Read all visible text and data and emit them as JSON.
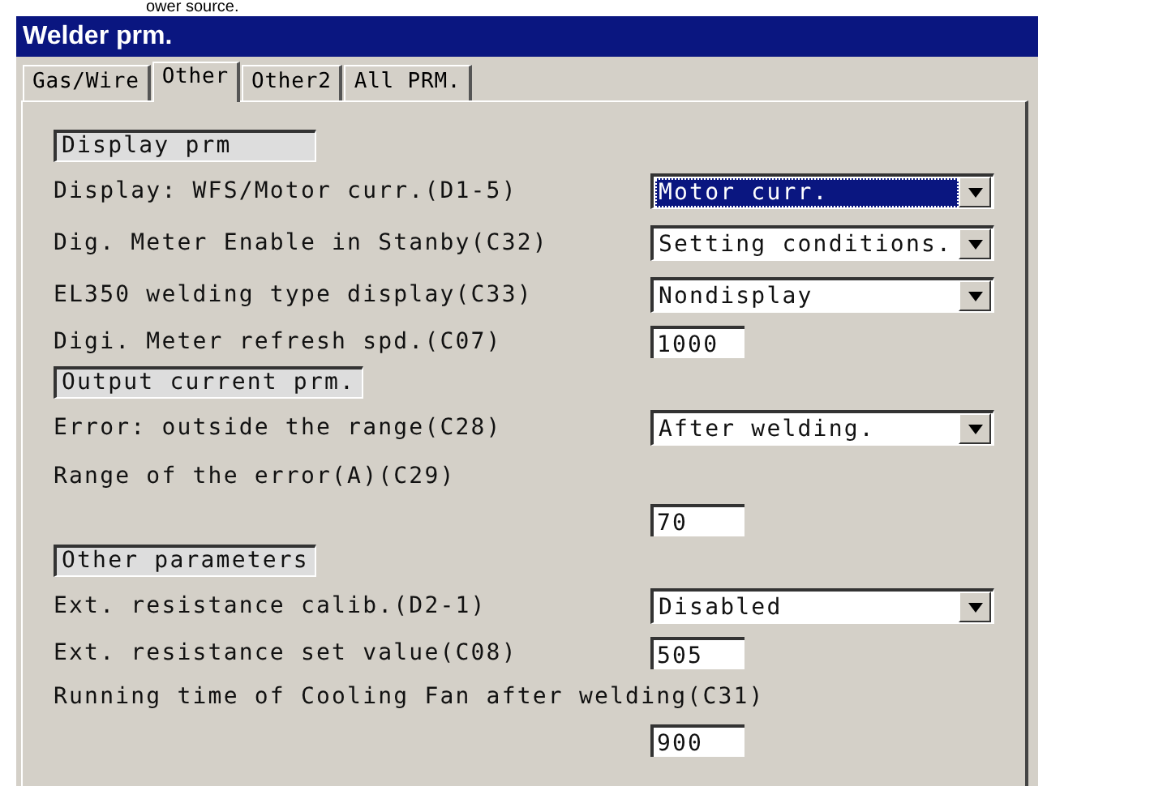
{
  "caption": "ower source.",
  "window": {
    "title": "Welder prm."
  },
  "tabs": [
    {
      "label": "Gas/Wire",
      "selected": false
    },
    {
      "label": "Other",
      "selected": true
    },
    {
      "label": "Other2",
      "selected": false
    },
    {
      "label": "All PRM.",
      "selected": false
    }
  ],
  "rows": [
    {
      "kind": "group",
      "label": "Display prm"
    },
    {
      "kind": "dropdown",
      "label": "Display: WFS/Motor curr.(D1-5)",
      "value": "Motor curr.",
      "focused": true
    },
    {
      "kind": "dropdown",
      "label": "Dig. Meter Enable in Stanby(C32)",
      "value": "Setting conditions.",
      "focused": false
    },
    {
      "kind": "dropdown",
      "label": "EL350 welding type display(C33)",
      "value": "Nondisplay",
      "focused": false
    },
    {
      "kind": "input",
      "label": "Digi. Meter refresh spd.(C07)",
      "value": "1000"
    },
    {
      "kind": "group",
      "label": "Output current prm."
    },
    {
      "kind": "dropdown",
      "label": "Error: outside the range(C28)",
      "value": "After welding.",
      "focused": false
    },
    {
      "kind": "label",
      "label": "Range of the error(A)(C29)"
    },
    {
      "kind": "input",
      "value": "70"
    },
    {
      "kind": "group",
      "label": "Other parameters"
    },
    {
      "kind": "dropdown",
      "label": "Ext. resistance calib.(D2-1)",
      "value": "Disabled",
      "focused": false
    },
    {
      "kind": "input",
      "label": "Ext. resistance set value(C08)",
      "value": "505"
    },
    {
      "kind": "label",
      "label": "Running time of Cooling Fan after welding(C31)"
    },
    {
      "kind": "input",
      "value": "900"
    }
  ]
}
